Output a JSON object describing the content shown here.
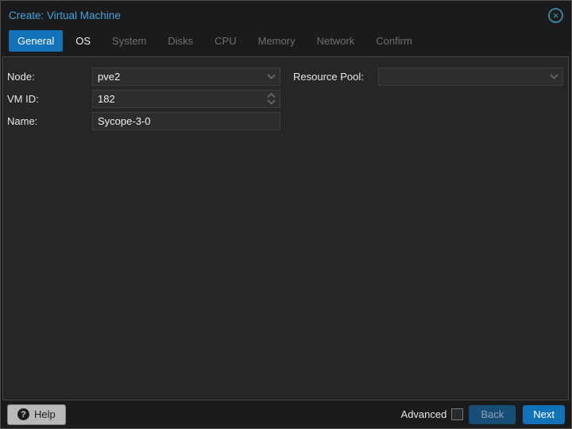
{
  "window": {
    "title": "Create: Virtual Machine"
  },
  "tabs": [
    {
      "label": "General",
      "state": "active"
    },
    {
      "label": "OS",
      "state": "enabled"
    },
    {
      "label": "System",
      "state": "disabled"
    },
    {
      "label": "Disks",
      "state": "disabled"
    },
    {
      "label": "CPU",
      "state": "disabled"
    },
    {
      "label": "Memory",
      "state": "disabled"
    },
    {
      "label": "Network",
      "state": "disabled"
    },
    {
      "label": "Confirm",
      "state": "disabled"
    }
  ],
  "form": {
    "node": {
      "label": "Node:",
      "value": "pve2",
      "type": "combo"
    },
    "vmid": {
      "label": "VM ID:",
      "value": "182",
      "type": "spinner"
    },
    "name": {
      "label": "Name:",
      "value": "Sycope-3-0",
      "type": "text"
    },
    "pool": {
      "label": "Resource Pool:",
      "value": "",
      "type": "combo"
    }
  },
  "footer": {
    "help_label": "Help",
    "advanced_label": "Advanced",
    "advanced_checked": false,
    "back_label": "Back",
    "next_label": "Next"
  },
  "colors": {
    "accent_blue": "#1172b8",
    "title_blue": "#46a1dc",
    "close_icon_teal": "#3f93b4",
    "panel_bg": "#262626",
    "window_bg": "#1b1b1b",
    "field_bg": "#2d2d2d",
    "disabled_tab_text": "#6f6f6f",
    "back_button_bg": "#174e78",
    "help_button_bg": "#b9b9b9"
  }
}
